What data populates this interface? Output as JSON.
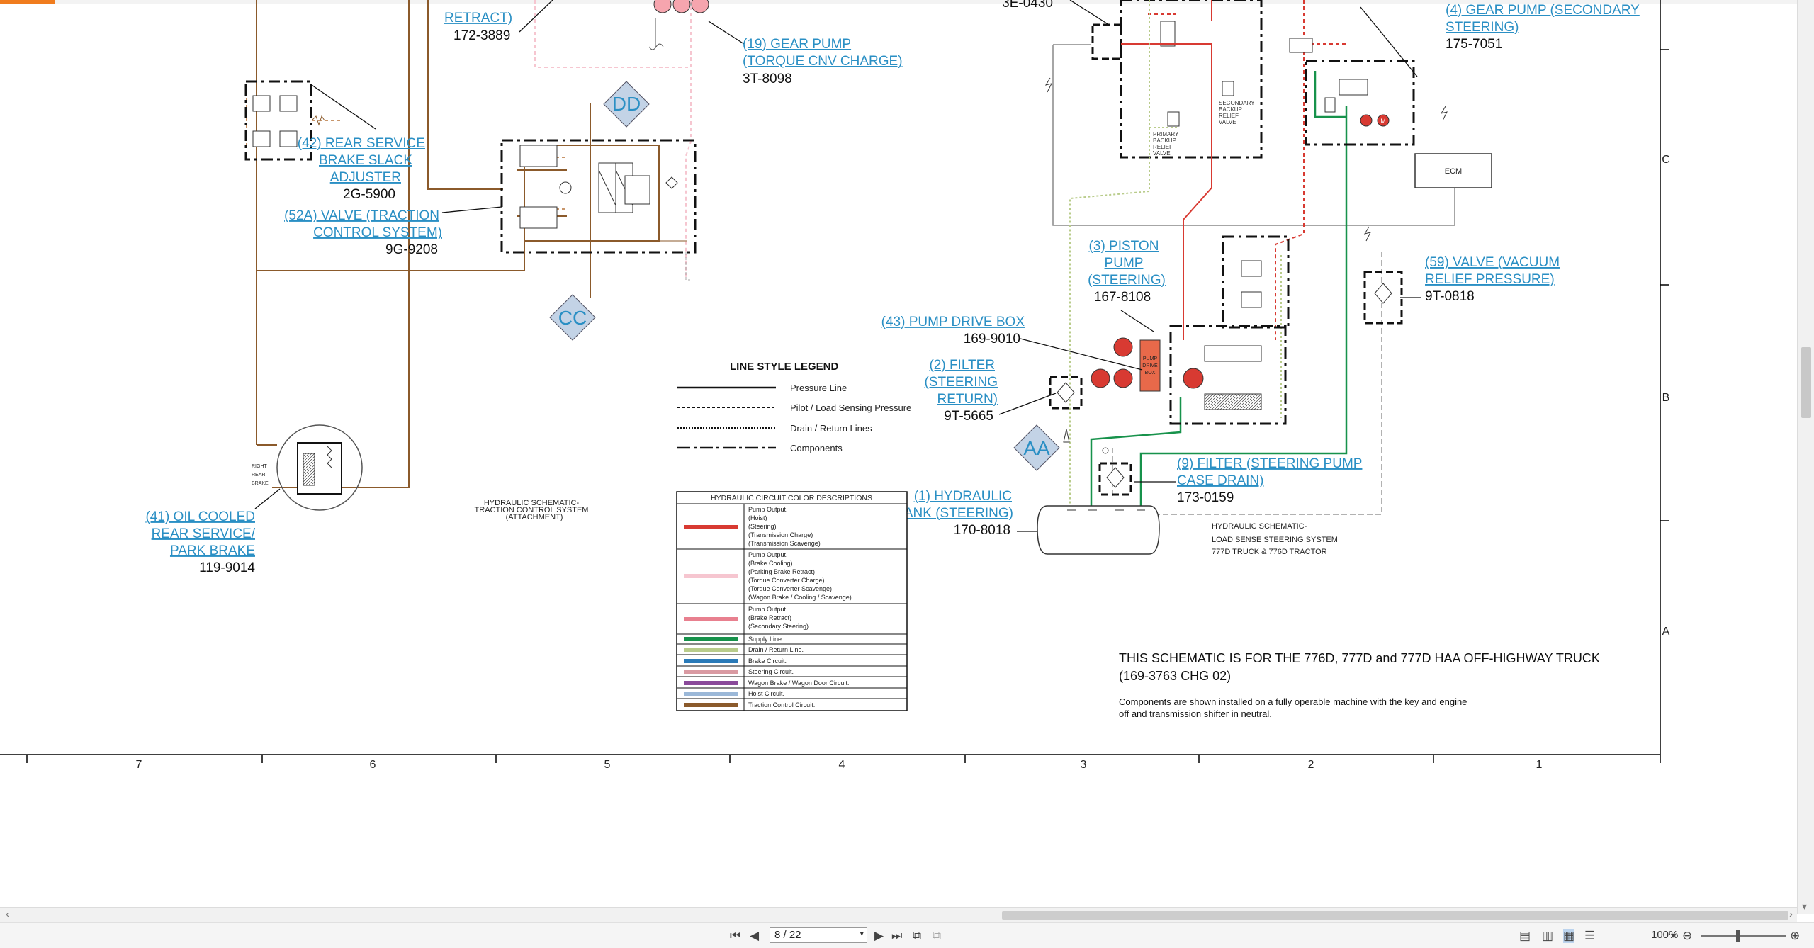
{
  "viewer": {
    "page_current": "8 / 22",
    "zoom": "100%",
    "icons": [
      "first-page-icon",
      "prev-page-icon",
      "next-page-icon",
      "last-page-icon",
      "view-icon",
      "compare-icon",
      "single-page-icon",
      "two-page-icon",
      "fit-page-icon",
      "scroll-mode-icon",
      "zoom-dropdown-icon",
      "zoom-out-icon",
      "zoom-in-icon"
    ]
  },
  "ruler": {
    "columns": [
      "7",
      "6",
      "5",
      "4",
      "3",
      "2",
      "1"
    ],
    "rows": [
      "C",
      "B",
      "A"
    ]
  },
  "callouts": {
    "c42": {
      "line1": "(42) REAR SERVICE",
      "line2": "BRAKE SLACK",
      "line3": "ADJUSTER",
      "part": "2G-5900"
    },
    "c52a": {
      "line1": "(52A)  VALVE (TRACTION",
      "line2": "CONTROL SYSTEM)",
      "part": "9G-9208"
    },
    "c41": {
      "line1": "(41) OIL COOLED",
      "line2": "REAR SERVICE/",
      "line3": "PARK BRAKE",
      "part": "119-9014"
    },
    "cretract": {
      "line1": "RETRACT)",
      "part": "172-3889"
    },
    "c19": {
      "line1": "(19)  GEAR PUMP",
      "line2": "(TORQUE CNV CHARGE)",
      "part": "3T-8098"
    },
    "c4": {
      "line1": "(4) GEAR  PUMP (SECONDARY",
      "line2": "STEERING)",
      "part": "175-7051"
    },
    "c3": {
      "line1": "(3)  PISTON",
      "line2": "PUMP",
      "line3": "(STEERING)",
      "part": "167-8108"
    },
    "c43": {
      "line1": "(43) PUMP  DRIVE BOX",
      "part": "169-9010"
    },
    "c2": {
      "line1": "(2)  FILTER",
      "line2": "(STEERING",
      "line3": "RETURN)",
      "part": "9T-5665"
    },
    "c1": {
      "line1": "(1) HYDRAULIC",
      "line2": "TANK (STEERING)",
      "part": "170-8018"
    },
    "c9": {
      "line1": "(9) FILTER (STEERING PUMP",
      "line2": "CASE DRAIN)",
      "part": "173-0159"
    },
    "c59": {
      "line1": "(59) VALVE (VACUUM",
      "line2": "RELIEF PRESSURE)",
      "part": "9T-0818"
    },
    "top_partial": "3E-0430"
  },
  "connectors": {
    "dd": "DD",
    "cc": "CC",
    "aa": "AA"
  },
  "small_labels": {
    "right_rear_brake": [
      "RIGHT",
      "REAR",
      "BRAKE"
    ],
    "secondary_relief": [
      "SECONDARY",
      "BACKUP",
      "RELIEF",
      "VALVE"
    ],
    "primary_relief": [
      "PRIMARY",
      "BACKUP",
      "RELIEF",
      "VALVE"
    ],
    "ecm": "ECM",
    "pump_drive_box": [
      "PUMP",
      "DRIVE",
      "BOX"
    ]
  },
  "schematic_titles": {
    "traction": [
      "HYDRAULIC SCHEMATIC-",
      "TRACTION CONTROL SYSTEM",
      "(ATTACHMENT)"
    ],
    "steering": [
      "HYDRAULIC SCHEMATIC-",
      "LOAD SENSE STEERING SYSTEM",
      "777D TRUCK & 776D TRACTOR"
    ]
  },
  "line_legend": {
    "title": "LINE STYLE LEGEND",
    "items": [
      "Pressure Line",
      "Pilot / Load Sensing Pressure",
      "Drain / Return Lines",
      "Components"
    ]
  },
  "color_legend": {
    "title": "HYDRAULIC CIRCUIT COLOR DESCRIPTIONS",
    "rows": [
      {
        "color": "#d83a32",
        "lines": [
          "Pump Output.",
          "(Hoist)",
          "(Steering)",
          "(Transmission Charge)",
          "(Transmission Scavenge)"
        ]
      },
      {
        "color": "#f6c6d0",
        "lines": [
          "Pump Output.",
          "(Brake Cooling)",
          "(Parking Brake Retract)",
          "(Torque Converter Charge)",
          "(Torque Converter Scavenge)",
          "(Wagon Brake / Cooling / Scavenge)"
        ]
      },
      {
        "color": "#e8808f",
        "lines": [
          "Pump Output.",
          "(Brake Retract)",
          "(Secondary Steering)"
        ]
      },
      {
        "color": "#17924b",
        "lines": [
          "Supply Line."
        ]
      },
      {
        "color": "#b9cc8b",
        "lines": [
          "Drain / Return Line."
        ]
      },
      {
        "color": "#2a7ab8",
        "lines": [
          "Brake Circuit."
        ]
      },
      {
        "color": "#d99aa2",
        "lines": [
          "Steering Circuit."
        ]
      },
      {
        "color": "#8a4a9a",
        "lines": [
          "Wagon Brake / Wagon Door Circuit."
        ]
      },
      {
        "color": "#9bb8d8",
        "lines": [
          "Hoist Circuit."
        ]
      },
      {
        "color": "#8b5a2b",
        "lines": [
          "Traction Control Circuit."
        ]
      }
    ]
  },
  "notes": {
    "line1": "THIS SCHEMATIC IS FOR THE 776D, 777D and 777D HAA OFF-HIGHWAY TRUCK",
    "line2": "(169-3763 CHG 02)",
    "line3": "Components are shown installed on a fully operable machine with the key and engine",
    "line4": "off and transmission shifter in neutral."
  },
  "colors": {
    "link": "#2a8fc4",
    "traction": "#8b5a2b",
    "pressure_red": "#d83a32",
    "supply_green": "#17924b",
    "drain_green": "#b9cc8b",
    "pink": "#f6c6d0",
    "diamond": "#c3d3e6"
  }
}
